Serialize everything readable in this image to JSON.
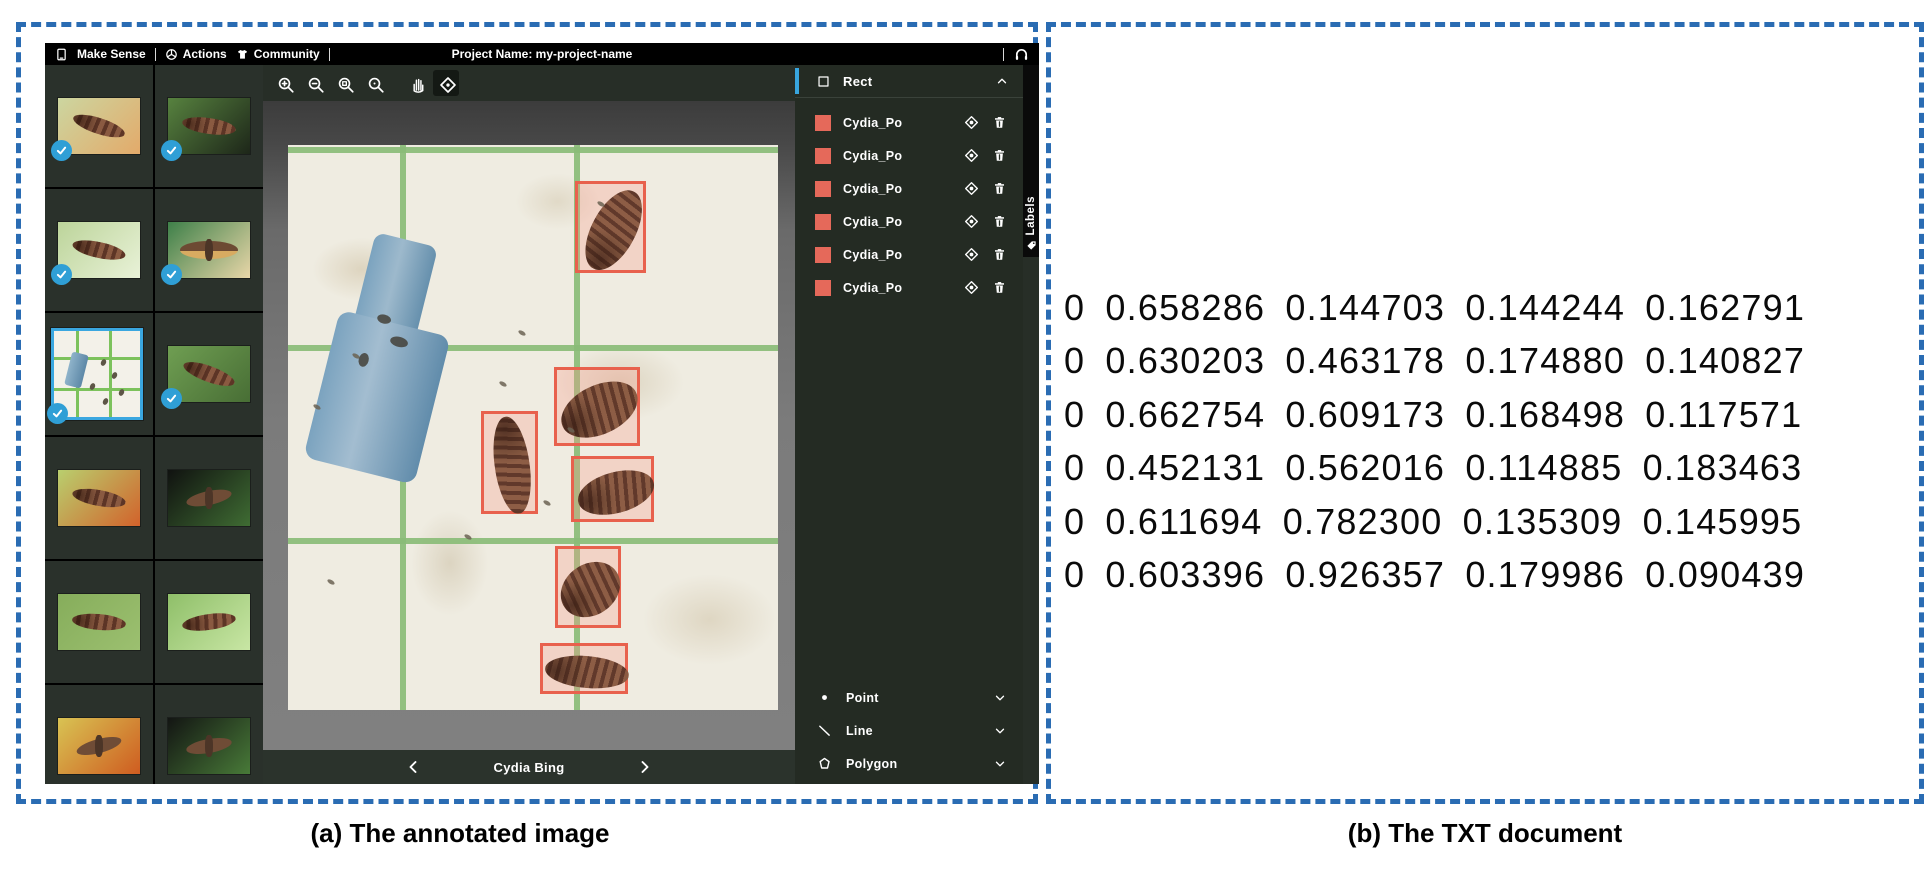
{
  "panel_a": {
    "caption": "(a) The annotated image",
    "menu_bar": {
      "brand": "Make Sense",
      "items": [
        {
          "label": "Actions",
          "icon": "actions-icon"
        },
        {
          "label": "Community",
          "icon": "community-icon"
        }
      ],
      "project_label": "Project Name: my-project-name",
      "right_icon": "headphones-icon"
    },
    "toolbar": {
      "buttons": [
        {
          "icon": "zoom-in-icon",
          "active": false
        },
        {
          "icon": "zoom-out-icon",
          "active": false
        },
        {
          "icon": "zoom-fit-icon",
          "active": false
        },
        {
          "icon": "zoom-max-icon",
          "active": false
        },
        {
          "icon": "drag-hand-icon",
          "active": false,
          "group_gap": true
        },
        {
          "icon": "select-tool-icon",
          "active": true
        }
      ]
    },
    "thumbnails": [
      {
        "type": "larva",
        "check": true,
        "selected": false,
        "c1": "#ccd6a0",
        "c2": "#e3aa6a",
        "angle": 18
      },
      {
        "type": "larva",
        "check": true,
        "selected": false,
        "c1": "#57823f",
        "c2": "#1d2619",
        "angle": 8
      },
      {
        "type": "larva",
        "check": true,
        "selected": false,
        "c1": "#bcd49a",
        "c2": "#e9f2d8",
        "angle": 12
      },
      {
        "type": "moth-spread",
        "check": true,
        "selected": false,
        "c1": "#3e8049",
        "c2": "#e8d6a8",
        "angle": 0
      },
      {
        "type": "trap",
        "check": true,
        "selected": true
      },
      {
        "type": "larva",
        "check": true,
        "selected": false,
        "c1": "#6f9e52",
        "c2": "#486e35",
        "angle": 20
      },
      {
        "type": "larva",
        "check": false,
        "selected": false,
        "c1": "#b9cf6e",
        "c2": "#d2622b",
        "angle": 10
      },
      {
        "type": "moth",
        "check": false,
        "selected": false,
        "c1": "#101210",
        "c2": "#3f6c33",
        "angle": -12
      },
      {
        "type": "larva",
        "check": false,
        "selected": false,
        "c1": "#86ad5b",
        "c2": "#9cc070",
        "angle": 5
      },
      {
        "type": "larva",
        "check": false,
        "selected": false,
        "c1": "#8fbf69",
        "c2": "#c8e6a4",
        "angle": -8
      },
      {
        "type": "moth",
        "check": false,
        "selected": false,
        "c1": "#d8c353",
        "c2": "#cf5c20",
        "angle": -15
      },
      {
        "type": "moth",
        "check": false,
        "selected": false,
        "c1": "#131513",
        "c2": "#487a38",
        "angle": -10
      }
    ],
    "editor_nav": {
      "label": "Cydia Bing"
    },
    "sidebar": {
      "rect_section": {
        "title": "Rect"
      },
      "labels": [
        {
          "name": "Cydia_Po"
        },
        {
          "name": "Cydia_Po"
        },
        {
          "name": "Cydia_Po"
        },
        {
          "name": "Cydia_Po"
        },
        {
          "name": "Cydia_Po"
        },
        {
          "name": "Cydia_Po"
        }
      ],
      "tools": [
        {
          "label": "Point",
          "icon": "point-icon"
        },
        {
          "label": "Line",
          "icon": "line-icon"
        },
        {
          "label": "Polygon",
          "icon": "polygon-icon"
        }
      ],
      "labels_tab": "Labels"
    },
    "annotations": {
      "class_color": "#e5695a",
      "box_border": "#e8614d",
      "boxes": [
        {
          "cls": 0,
          "cx": 0.658286,
          "cy": 0.144703,
          "w": 0.144244,
          "h": 0.162791,
          "larva_angle": -62
        },
        {
          "cls": 0,
          "cx": 0.630203,
          "cy": 0.463178,
          "w": 0.17488,
          "h": 0.140827,
          "larva_angle": -25
        },
        {
          "cls": 0,
          "cx": 0.662754,
          "cy": 0.609173,
          "w": 0.168498,
          "h": 0.117571,
          "larva_angle": -15
        },
        {
          "cls": 0,
          "cx": 0.452131,
          "cy": 0.562016,
          "w": 0.114885,
          "h": 0.183463,
          "larva_angle": 82
        },
        {
          "cls": 0,
          "cx": 0.611694,
          "cy": 0.7823,
          "w": 0.135309,
          "h": 0.145995,
          "larva_angle": -35
        },
        {
          "cls": 0,
          "cx": 0.603396,
          "cy": 0.926357,
          "w": 0.179986,
          "h": 0.090439,
          "larva_angle": 5
        }
      ],
      "debris": [
        [
          0.13,
          0.37
        ],
        [
          0.05,
          0.46
        ],
        [
          0.47,
          0.33
        ],
        [
          0.43,
          0.42
        ],
        [
          0.57,
          0.5
        ],
        [
          0.08,
          0.77
        ],
        [
          0.63,
          0.1
        ],
        [
          0.36,
          0.69
        ],
        [
          0.52,
          0.63
        ]
      ]
    }
  },
  "panel_b": {
    "caption": "(b) The TXT document",
    "lines": [
      "0 0.658286 0.144703 0.144244 0.162791",
      "0 0.630203 0.463178 0.174880 0.140827",
      "0 0.662754 0.609173 0.168498 0.117571",
      "0 0.452131 0.562016 0.114885 0.183463",
      "0 0.611694 0.782300 0.135309 0.145995",
      "0 0.603396 0.926357 0.179986 0.090439"
    ]
  }
}
